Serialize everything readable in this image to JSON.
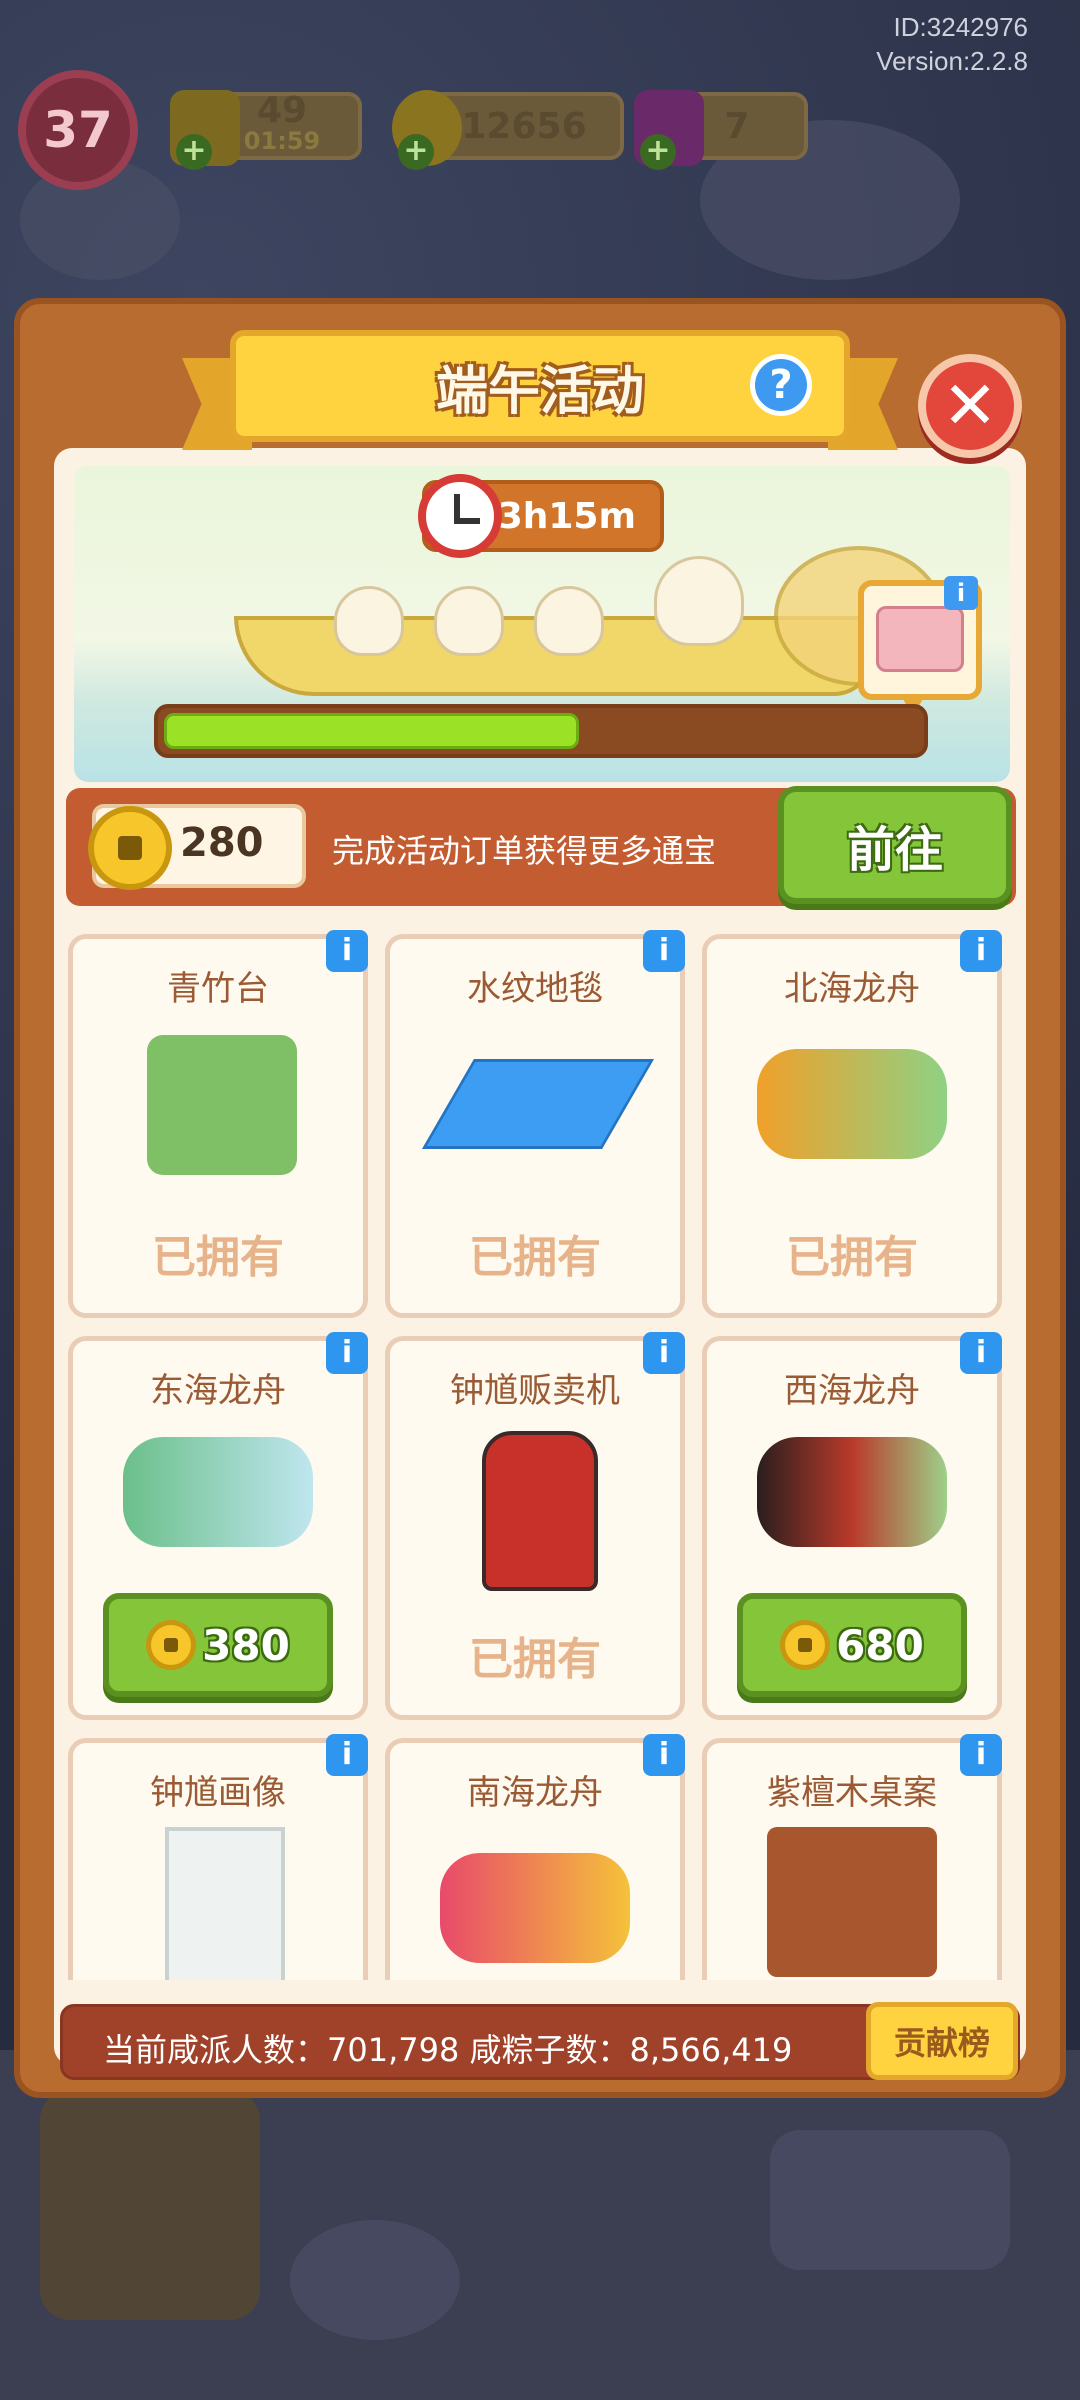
{
  "hud": {
    "id_text": "ID:3242976",
    "version_text": "Version:2.2.8",
    "level": "37",
    "energy": "49",
    "energy_timer": "01:59",
    "coins": "12656",
    "gems": "7"
  },
  "modal": {
    "title": "端午活动",
    "help_label": "?",
    "close_label": "✕",
    "timer": "3h15m",
    "progress": 0.55,
    "reward_info_label": "i"
  },
  "task": {
    "coins": "280",
    "text": "完成活动订单获得更多通宝",
    "go_label": "前往"
  },
  "items": [
    {
      "name": "青竹台",
      "status": "已拥有"
    },
    {
      "name": "水纹地毯",
      "status": "已拥有"
    },
    {
      "name": "北海龙舟",
      "status": "已拥有"
    },
    {
      "name": "东海龙舟",
      "price": "380"
    },
    {
      "name": "钟馗贩卖机",
      "status": "已拥有"
    },
    {
      "name": "西海龙舟",
      "price": "680"
    },
    {
      "name": "钟馗画像"
    },
    {
      "name": "南海龙舟"
    },
    {
      "name": "紫檀木桌案"
    }
  ],
  "info_label": "i",
  "footer": {
    "stats": "当前咸派人数：701,798   咸粽子数：8,566,419",
    "rank_label": "贡献榜"
  },
  "colors": {
    "panel": "#b86c2f",
    "accent_green": "#85c53a",
    "title_yellow": "#ffd23f",
    "close_red": "#e3463b"
  }
}
